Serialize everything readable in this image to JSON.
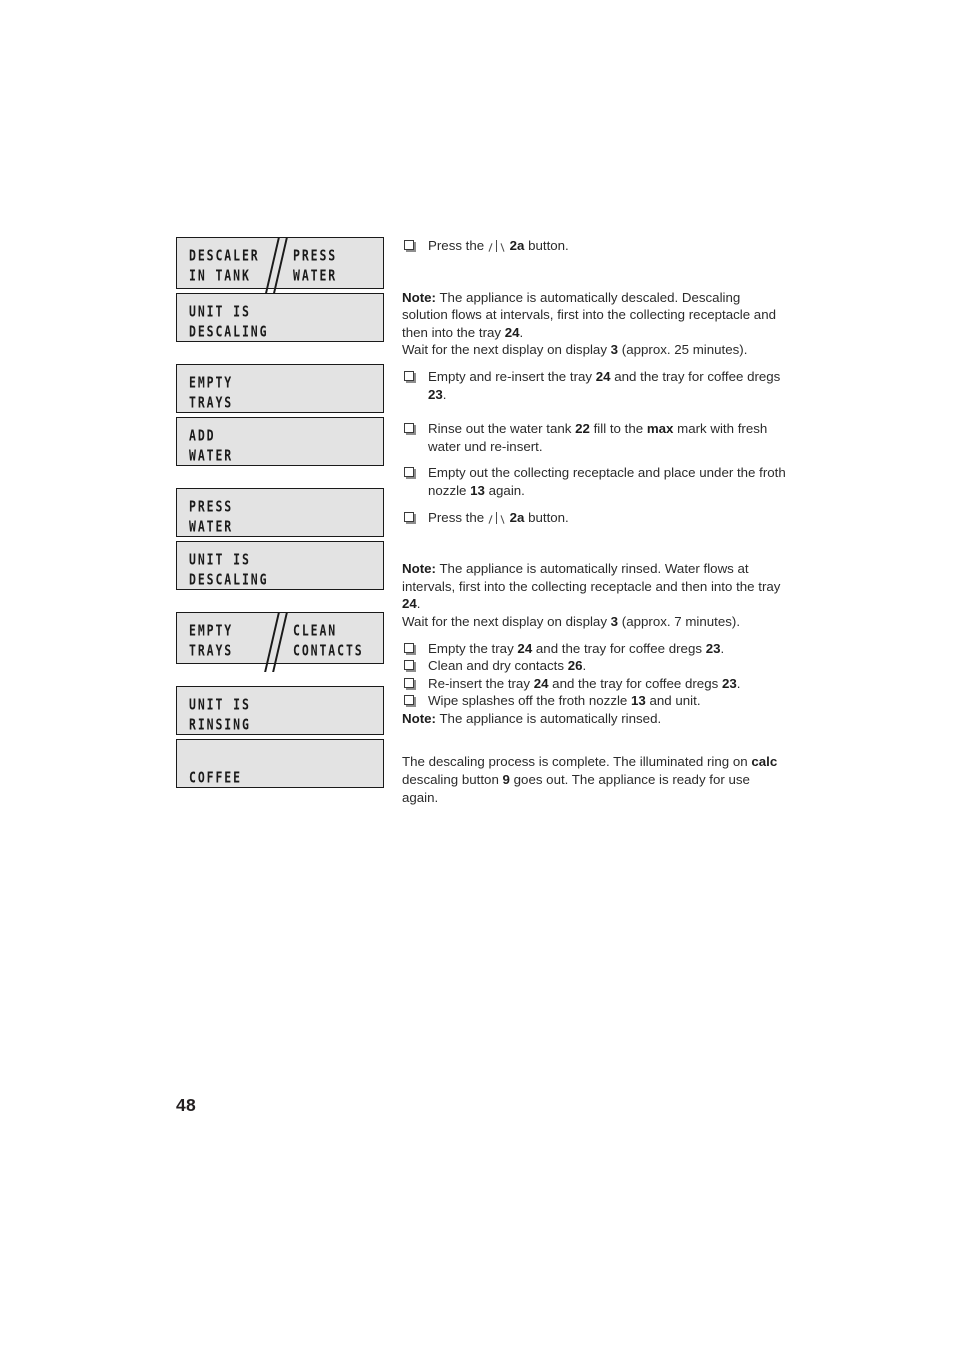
{
  "page": {
    "number": "48",
    "background_color": "#ffffff",
    "text_color": "#2b2b2b"
  },
  "display_panel": {
    "lcd_background": "#e3e3e3",
    "lcd_border": "#1a1a1a",
    "groups": [
      {
        "boxes": [
          {
            "split": true,
            "left": {
              "line1": "DESCALER",
              "line2": "IN TANK"
            },
            "right": {
              "line1": "PRESS",
              "line2": "WATER"
            }
          },
          {
            "split": false,
            "left": {
              "line1": "UNIT IS",
              "line2": "DESCALING"
            }
          }
        ]
      },
      {
        "boxes": [
          {
            "split": false,
            "left": {
              "line1": "EMPTY",
              "line2": "TRAYS"
            }
          },
          {
            "split": false,
            "left": {
              "line1": "ADD",
              "line2": "WATER"
            }
          }
        ]
      },
      {
        "boxes": [
          {
            "split": false,
            "left": {
              "line1": "PRESS",
              "line2": "WATER"
            }
          },
          {
            "split": false,
            "left": {
              "line1": "UNIT IS",
              "line2": "DESCALING"
            }
          }
        ]
      },
      {
        "boxes": [
          {
            "split": true,
            "left": {
              "line1": "EMPTY",
              "line2": "TRAYS"
            },
            "right": {
              "line1": "CLEAN",
              "line2": "CONTACTS"
            }
          }
        ]
      },
      {
        "boxes": [
          {
            "split": false,
            "left": {
              "line1": "UNIT IS",
              "line2": "RINSING"
            }
          },
          {
            "split": false,
            "left": {
              "line1": "",
              "line2": "COFFEE"
            }
          }
        ]
      }
    ]
  },
  "instructions": {
    "step_press_2a_1": {
      "pre": "Press the",
      "icon": "steam-icon",
      "ref": "2a",
      "post": "button."
    },
    "note_descaling": {
      "label": "Note:",
      "body_1": " The appliance is automatically descaled. Descaling solution flows at intervals, first into the collecting receptacle and then into the tray ",
      "ref_1": "24",
      "body_2": ".",
      "wait_pre": "Wait for the next display on display ",
      "wait_ref": "3",
      "wait_post": " (approx. 25 minutes)."
    },
    "step_empty_reinsert": {
      "pre": "Empty and re-insert the tray ",
      "ref_1": "24",
      "mid": " and the tray for coffee dregs ",
      "ref_2": "23",
      "post": "."
    },
    "step_rinse_tank": {
      "pre": "Rinse out the water tank ",
      "ref_1": "22",
      "mid_1": " fill to the ",
      "bold_max": "max",
      "mid_2": " mark with fresh water und re-insert."
    },
    "step_empty_receptacle": {
      "pre": "Empty out the collecting receptacle and place under the froth nozzle ",
      "ref_1": "13",
      "post": " again."
    },
    "step_press_2a_2": {
      "pre": "Press the",
      "icon": "steam-icon",
      "ref": "2a",
      "post": "button."
    },
    "note_rinsing": {
      "label": "Note:",
      "body_1": " The appliance is automatically rinsed. Water flows at intervals, first into the collecting receptacle and then into the tray  ",
      "ref_1": "24",
      "body_2": ".",
      "wait_pre": "Wait for the next display on display ",
      "wait_ref": "3",
      "wait_post": " (approx. 7 minutes)."
    },
    "step_empty_tray": {
      "pre": "Empty the tray ",
      "ref_1": "24",
      "mid": " and the tray for coffee dregs ",
      "ref_2": "23",
      "post": "."
    },
    "step_clean_contacts": {
      "pre": "Clean and dry contacts ",
      "ref_1": "26",
      "post": "."
    },
    "step_reinsert_tray": {
      "pre": "Re-insert the tray ",
      "ref_1": "24",
      "mid": " and the tray for coffee dregs ",
      "ref_2": "23",
      "post": "."
    },
    "step_wipe_splashes": {
      "pre": "Wipe splashes off the froth nozzle ",
      "ref_1": "13",
      "post": " and unit."
    },
    "note_rinsed_short": {
      "label": "Note:",
      "body_1": " The appliance is automatically rinsed."
    },
    "closing": {
      "part_1": "The descaling process is complete. The illuminated ring on ",
      "bold_calc": "calc",
      "part_2": " descaling button ",
      "ref_1": "9",
      "part_3": " goes out. The appliance is ready for use again."
    }
  }
}
